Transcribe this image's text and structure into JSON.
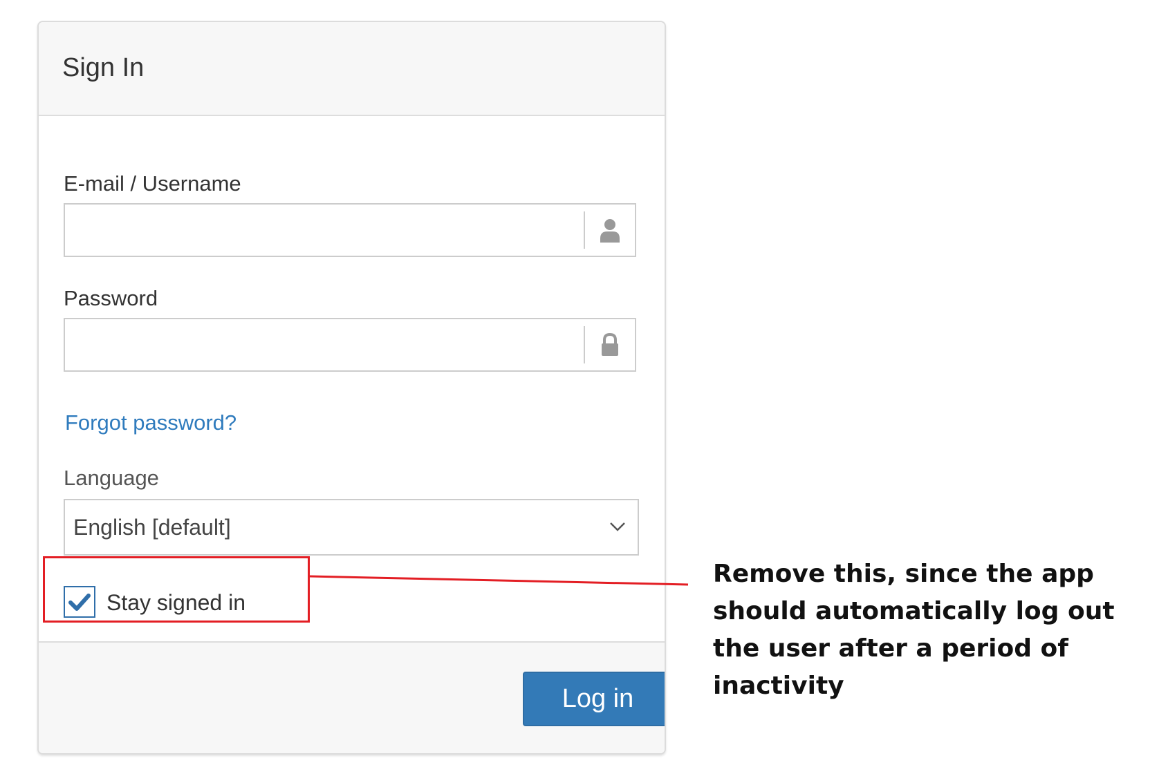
{
  "card": {
    "title": "Sign In"
  },
  "form": {
    "username": {
      "label": "E-mail / Username",
      "value": "",
      "placeholder": "",
      "icon": "user-icon"
    },
    "password": {
      "label": "Password",
      "value": "",
      "placeholder": "",
      "icon": "lock-icon"
    },
    "forgot_password": "Forgot password?",
    "language": {
      "label": "Language",
      "selected": "English [default]",
      "icon": "chevron-down-icon"
    },
    "stay_signed_in": {
      "label": "Stay signed in",
      "checked": true,
      "icon": "checkmark-icon"
    }
  },
  "footer": {
    "login_label": "Log in"
  },
  "annotation": {
    "text": "Remove this, since the app should automatically log out the user after a period of inactivity",
    "color": "#e31e24"
  },
  "colors": {
    "primary": "#337ab7",
    "link": "#2f7bbd",
    "header_bg": "#f7f7f7"
  }
}
